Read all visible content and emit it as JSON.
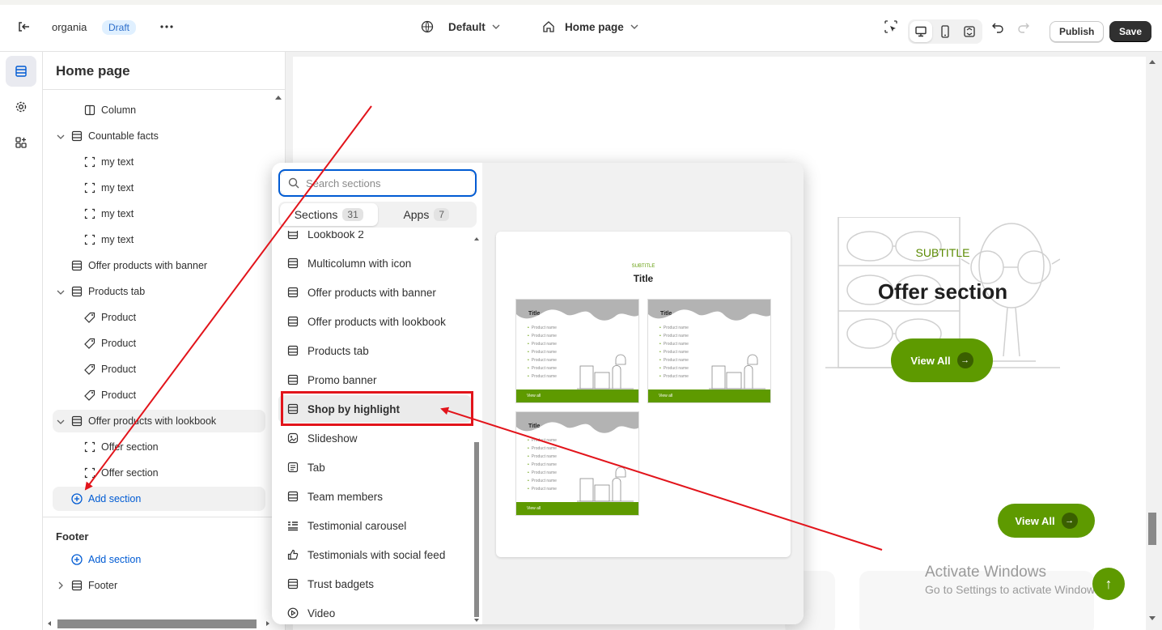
{
  "topbar": {
    "store_name": "organia",
    "status_badge": "Draft",
    "theme_selector": "Default",
    "page_selector": "Home page",
    "publish_label": "Publish",
    "save_label": "Save"
  },
  "sidebar": {
    "title": "Home page",
    "tree": [
      {
        "label": "Column",
        "icon": "column-icon"
      },
      {
        "label": "Countable facts",
        "icon": "section-icon"
      },
      {
        "label": "my text",
        "icon": "block-icon"
      },
      {
        "label": "my text",
        "icon": "block-icon"
      },
      {
        "label": "my text",
        "icon": "block-icon"
      },
      {
        "label": "my text",
        "icon": "block-icon"
      },
      {
        "label": "Offer products with banner",
        "icon": "section-icon"
      },
      {
        "label": "Products tab",
        "icon": "section-icon"
      },
      {
        "label": "Product",
        "icon": "tag-icon"
      },
      {
        "label": "Product",
        "icon": "tag-icon"
      },
      {
        "label": "Product",
        "icon": "tag-icon"
      },
      {
        "label": "Product",
        "icon": "tag-icon"
      },
      {
        "label": "Offer products with lookbook",
        "icon": "section-icon"
      },
      {
        "label": "Offer section",
        "icon": "block-icon"
      },
      {
        "label": "Offer section",
        "icon": "block-icon"
      }
    ],
    "add_section_label": "Add section",
    "footer_heading": "Footer",
    "footer_add_section_label": "Add section",
    "footer_item": "Footer"
  },
  "popover": {
    "search_placeholder": "Search sections",
    "tabs": [
      {
        "label": "Sections",
        "count": "31"
      },
      {
        "label": "Apps",
        "count": "7"
      }
    ],
    "sections": [
      {
        "label": "Lookbook 2",
        "icon": "section-icon"
      },
      {
        "label": "Multicolumn with icon",
        "icon": "section-icon"
      },
      {
        "label": "Offer products with banner",
        "icon": "section-icon"
      },
      {
        "label": "Offer products with lookbook",
        "icon": "section-icon"
      },
      {
        "label": "Products tab",
        "icon": "section-icon"
      },
      {
        "label": "Promo banner",
        "icon": "section-icon"
      },
      {
        "label": "Shop by highlight",
        "icon": "section-icon"
      },
      {
        "label": "Slideshow",
        "icon": "slideshow-icon"
      },
      {
        "label": "Tab",
        "icon": "tab-icon"
      },
      {
        "label": "Team members",
        "icon": "section-icon"
      },
      {
        "label": "Testimonial carousel",
        "icon": "testimonial-icon"
      },
      {
        "label": "Testimonials with social feed",
        "icon": "thumbs-up-icon"
      },
      {
        "label": "Trust badgets",
        "icon": "section-icon"
      },
      {
        "label": "Video",
        "icon": "play-icon"
      }
    ],
    "preview": {
      "subtitle": "SUBTITLE",
      "title": "Title",
      "card_title": "Title",
      "product_name": "Product name",
      "card_button": "View all"
    }
  },
  "canvas": {
    "offer_subtitle": "SUBTITLE",
    "offer_title": "Offer section",
    "view_all_1": "View All",
    "view_all_2": "View All",
    "watermark_line1": "Activate Windows",
    "watermark_line2": "Go to Settings to activate Windows."
  },
  "colors": {
    "accent_blue": "#005bd3",
    "brand_green": "#5e9a00",
    "annotation_red": "#e2141b"
  }
}
